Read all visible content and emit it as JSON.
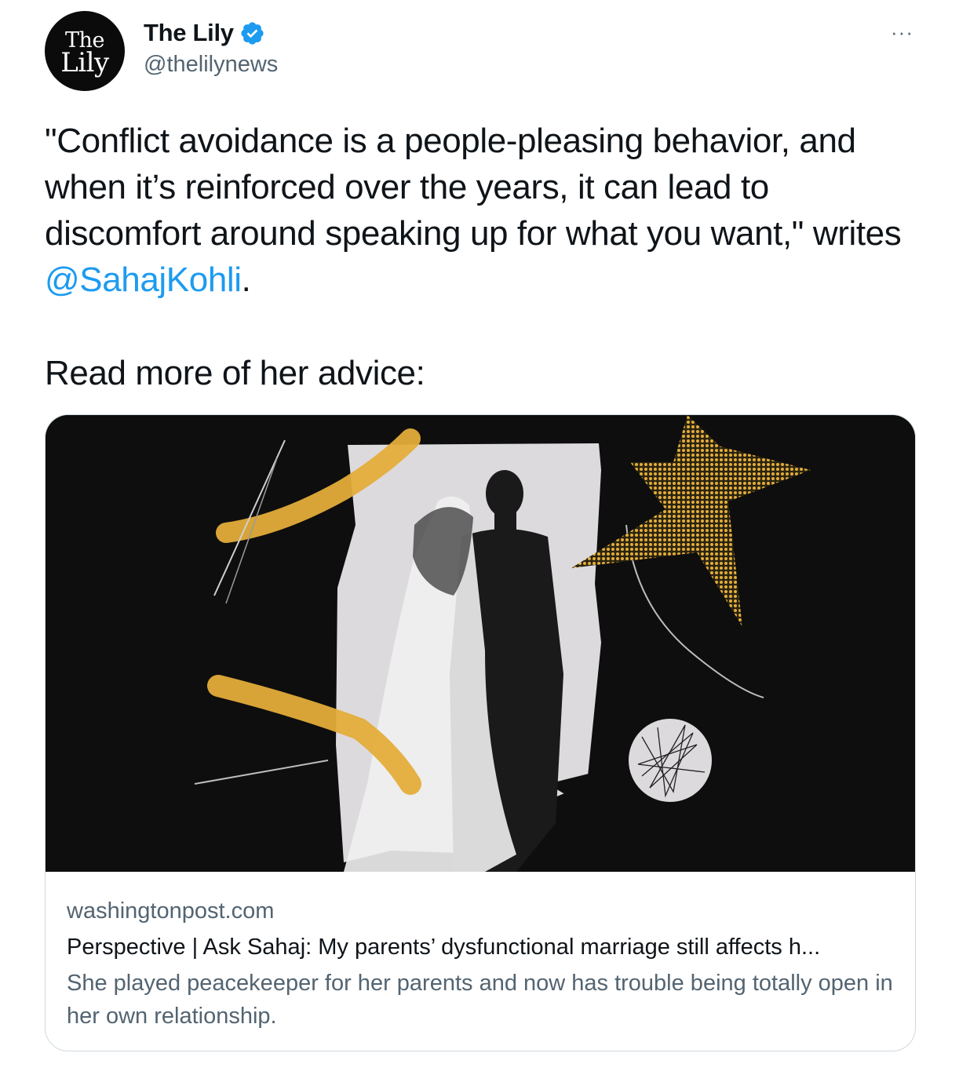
{
  "account": {
    "avatar_line1": "The",
    "avatar_line2": "Lily",
    "display_name": "The Lily",
    "handle": "@thelilynews",
    "verified_icon": "verified-badge-icon",
    "more_label": "···"
  },
  "tweet": {
    "text_before_mention": "\"Conflict avoidance is a people-pleasing behavior, and when it’s reinforced over the years, it can lead to discomfort around speaking up for what you want,\" writes ",
    "mention": "@SahajKohli",
    "text_after_mention": ".",
    "cta": "Read more of her advice:"
  },
  "link_card": {
    "domain": "washingtonpost.com",
    "title": "Perspective | Ask Sahaj: My parents’ dysfunctional marriage still affects h...",
    "description": "She played peacekeeper for her parents and now has trouble being totally open in her own relationship."
  },
  "colors": {
    "accent": "#1d9bf0",
    "secondary_text": "#536471",
    "card_border": "#cfd9de",
    "mustard": "#e4ad3a"
  }
}
